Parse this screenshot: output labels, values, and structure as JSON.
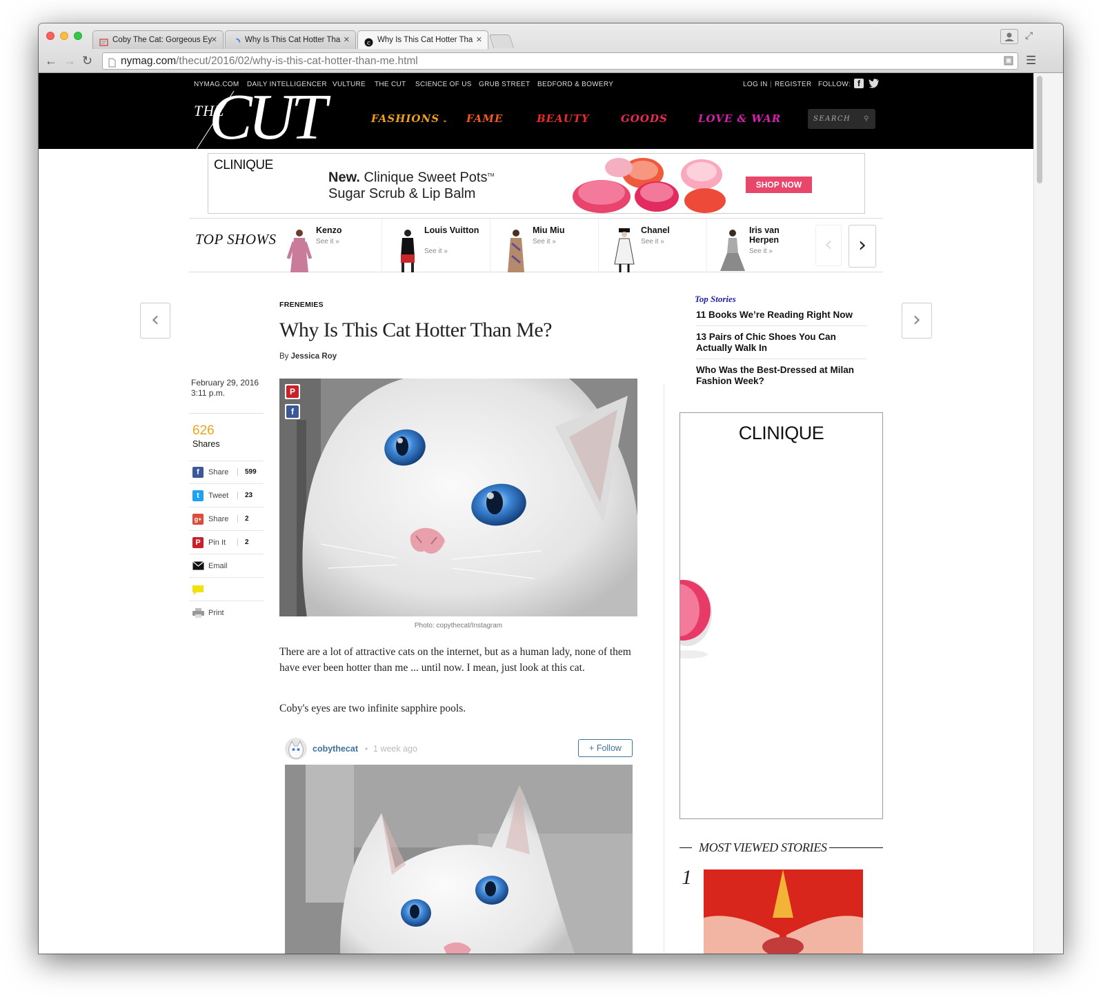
{
  "browser": {
    "tabs": [
      {
        "label": "Coby The Cat: Gorgeous Ey"
      },
      {
        "label": "Why Is This Cat Hotter Tha"
      },
      {
        "label": "Why Is This Cat Hotter Tha"
      }
    ],
    "url_host": "nymag.com",
    "url_path": "/thecut/2016/02/why-is-this-cat-hotter-than-me.html"
  },
  "network": {
    "links": [
      "NYMAG.COM",
      "DAILY INTELLIGENCER",
      "VULTURE",
      "THE CUT",
      "SCIENCE OF US",
      "GRUB STREET",
      "BEDFORD & BOWERY"
    ],
    "login": "LOG IN",
    "register": "REGISTER",
    "follow": "FOLLOW:"
  },
  "header": {
    "logo_the": "THE",
    "logo_cut": "CUT",
    "nav": [
      {
        "label": "FASHIONS",
        "color": "#f0a21b"
      },
      {
        "label": "FAME",
        "color": "#f25a1e"
      },
      {
        "label": "BEAUTY",
        "color": "#ee2a2a"
      },
      {
        "label": "GOODS",
        "color": "#ee2a55"
      },
      {
        "label": "LOVE & WAR",
        "color": "#d81fb0"
      }
    ],
    "search_placeholder": "SEARCH"
  },
  "banner_ad": {
    "brand": "CLINIQUE",
    "headline_bold": "New.",
    "headline_rest": "Clinique Sweet Pots",
    "tm": "TM",
    "line2": "Sugar Scrub & Lip Balm",
    "cta": "SHOP NOW"
  },
  "top_shows": {
    "title": "TOP SHOWS",
    "see": "See it »",
    "items": [
      {
        "name": "Kenzo"
      },
      {
        "name": "Louis Vuitton"
      },
      {
        "name": "Miu Miu"
      },
      {
        "name": "Chanel"
      },
      {
        "name": "Iris van Herpen"
      }
    ]
  },
  "article": {
    "rubric": "FRENEMIES",
    "title": "Why Is This Cat Hotter Than Me?",
    "by": "By",
    "author": "Jessica Roy",
    "date": "February 29, 2016",
    "time": "3:11 p.m.",
    "photo_credit": "Photo: copythecat/Instagram",
    "paragraphs": [
      "There are a lot of attractive cats on the internet, but as a human lady, none of them have ever been hotter than me ... until now. I mean, just look at this cat.",
      "Coby's eyes are two infinite sapphire pools."
    ],
    "shares_count": "626",
    "shares_label": "Shares",
    "share_buttons": [
      {
        "label": "Share",
        "count": "599",
        "color": "#3b5998",
        "glyph": "f"
      },
      {
        "label": "Tweet",
        "count": "23",
        "color": "#1da1f2",
        "glyph": "t"
      },
      {
        "label": "Share",
        "count": "2",
        "color": "#dd4b39",
        "glyph": "g+"
      },
      {
        "label": "Pin It",
        "count": "2",
        "color": "#cb2027",
        "glyph": "P"
      }
    ],
    "email_label": "Email",
    "print_label": "Print"
  },
  "instagram": {
    "username": "cobythecat",
    "dot": "•",
    "ago": "1 week ago",
    "follow": "+ Follow"
  },
  "sidebar": {
    "top_stories_title": "Top Stories",
    "stories": [
      "11 Books We’re Reading Right Now",
      "13 Pairs of Chic Shoes You Can Actually Walk In",
      "Who Was the Best-Dressed at Milan Fashion Week?"
    ],
    "ad_brand": "CLINIQUE",
    "most_viewed_title": "MOST VIEWED STORIES",
    "most_viewed_rank": "1"
  },
  "colors": {
    "accent_orange": "#f0a21b",
    "top_stories_blue": "#2222aa",
    "cta_pink": "#e8476b"
  }
}
